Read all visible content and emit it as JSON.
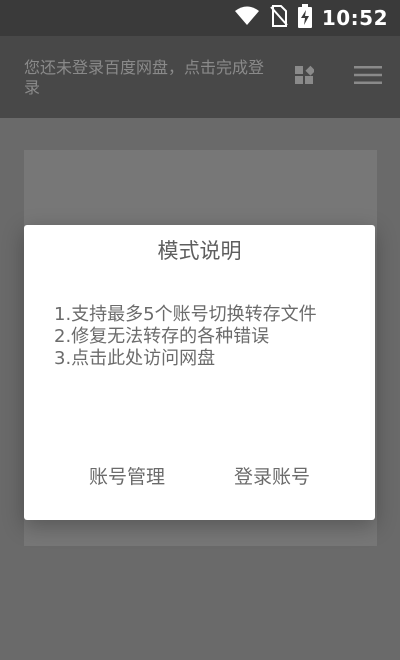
{
  "status_bar": {
    "time": "10:52",
    "icons": [
      "wifi-icon",
      "no-sim-icon",
      "battery-charging-icon"
    ]
  },
  "app_bar": {
    "title": "您还未登录百度网盘，点击完成登录",
    "actions": [
      "grid-icon",
      "menu-icon"
    ],
    "title_color": "#8a8a8a",
    "background": "#484848"
  },
  "dialog": {
    "title": "模式说明",
    "lines": [
      "1.支持最多5个账号切换转存文件",
      "2.修复无法转存的各种错误",
      "3.点击此处访问网盘"
    ],
    "buttons": {
      "account_manage": "账号管理",
      "login_account": "登录账号"
    }
  }
}
